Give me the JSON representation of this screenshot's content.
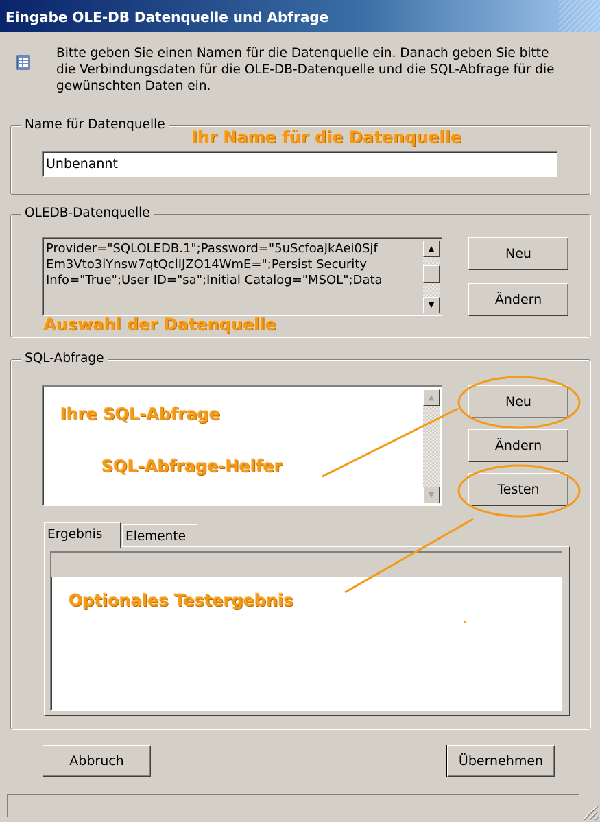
{
  "window": {
    "title": "Eingabe OLE-DB Datenquelle und Abfrage"
  },
  "intro": {
    "text": "Bitte geben Sie einen Namen für die Datenquelle ein. Danach geben Sie bitte die Verbindungsdaten für die OLE-DB-Datenquelle und die SQL-Abfrage für die gewünschten Daten ein.",
    "icon": "database-info-icon"
  },
  "name_group": {
    "legend": "Name für Datenquelle",
    "value": "Unbenannt",
    "annotation": "Ihr Name für die Datenquelle"
  },
  "oledb_group": {
    "legend": "OLEDB-Datenquelle",
    "connection_lines": [
      "Provider=\"SQLOLEDB.1\";Password=\"5uScfoaJkAei0Sjf",
      "Em3Vto3iYnsw7qtQclIJZO14WmE=\";Persist Security",
      "Info=\"True\";User ID=\"sa\";Initial Catalog=\"MSOL\";Data"
    ],
    "new_label": "Neu",
    "change_label": "Ändern",
    "annotation": "Auswahl der Datenquelle"
  },
  "sql_group": {
    "legend": "SQL-Abfrage",
    "query_value": "",
    "new_label": "Neu",
    "change_label": "Ändern",
    "test_label": "Testen",
    "annotation_query": "Ihre SQL-Abfrage",
    "annotation_helper": "SQL-Abfrage-Helfer",
    "annotation_result": "Optionales Testergebnis",
    "tabs": [
      {
        "label": "Ergebnis",
        "selected": true
      },
      {
        "label": "Elemente",
        "selected": false
      }
    ]
  },
  "footer": {
    "cancel_label": "Abbruch",
    "apply_label": "Übernehmen"
  },
  "colors": {
    "annotation": "#f39a1a",
    "title_start": "#0a246a",
    "title_end": "#a6caf0"
  }
}
